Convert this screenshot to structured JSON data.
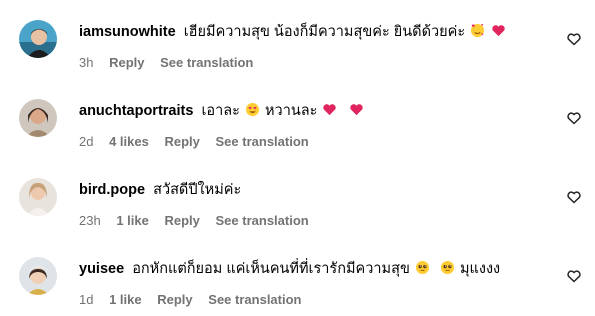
{
  "comments": [
    {
      "username": "iamsunowhite",
      "text_parts": [
        "เฮียมีความสุข น้องก็มีความสุขค่ะ ยินดีด้วยค่ะ",
        "",
        ""
      ],
      "emojis": [
        "smiling-face-with-hearts",
        "red-heart"
      ],
      "time": "3h",
      "likes": "",
      "reply": "Reply",
      "see_translation": "See translation"
    },
    {
      "username": "anuchtaportraits",
      "text_parts": [
        "เอาละ",
        "หวานละ",
        ""
      ],
      "emojis": [
        "heart-eyes",
        "red-heart",
        "red-heart"
      ],
      "time": "2d",
      "likes": "4 likes",
      "reply": "Reply",
      "see_translation": "See translation"
    },
    {
      "username": "bird.pope",
      "text_parts": [
        "สวัสดีปีใหม่ค่ะ"
      ],
      "emojis": [],
      "time": "23h",
      "likes": "1 like",
      "reply": "Reply",
      "see_translation": "See translation"
    },
    {
      "username": "yuisee",
      "text_parts": [
        "อกหักแต่ก็ยอม แค่เห็นคนที่ที่เรารักมีความสุข",
        "มุแงงง"
      ],
      "emojis": [
        "pleading-face",
        "pleading-face"
      ],
      "time": "1d",
      "likes": "1 like",
      "reply": "Reply",
      "see_translation": "See translation"
    }
  ],
  "colors": {
    "meta_text": "#737373",
    "heart_red": "#e0245e",
    "emoji_yellow": "#ffcc33"
  },
  "icons": {
    "like": "heart-outline-icon"
  }
}
